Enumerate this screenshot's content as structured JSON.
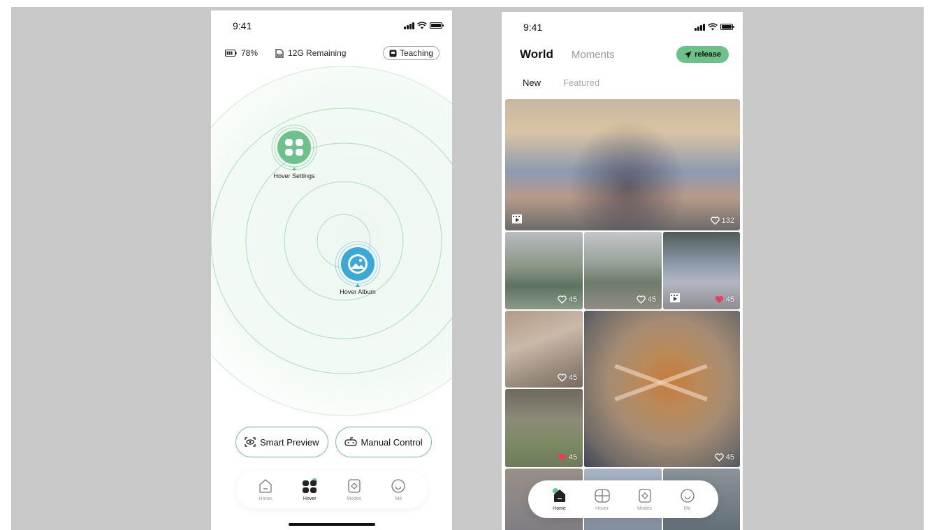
{
  "left_phone": {
    "status": {
      "time": "9:41"
    },
    "info": {
      "battery": "78%",
      "storage": "12G Remaining",
      "teaching_label": "Teaching"
    },
    "nodes": {
      "settings_label": "Hover Settings",
      "album_label": "Hover Album"
    },
    "actions": {
      "smart_preview": "Smart Preview",
      "manual_control": "Manual Control"
    },
    "tabs": [
      {
        "label": "Home",
        "icon": "home-icon"
      },
      {
        "label": "Hover",
        "icon": "hover-icon"
      },
      {
        "label": "Modes",
        "icon": "modes-icon"
      },
      {
        "label": "Me",
        "icon": "me-icon"
      }
    ],
    "colors": {
      "accent": "#6dc28c",
      "album": "#3aa9d8"
    }
  },
  "right_phone": {
    "status": {
      "time": "9:41"
    },
    "header": {
      "world": "World",
      "moments": "Moments",
      "release": "release"
    },
    "subtabs": {
      "new": "New",
      "featured": "Featured"
    },
    "feed": [
      {
        "likes": "132",
        "liked": false,
        "video": true
      },
      {
        "likes": "45",
        "liked": false,
        "video": false
      },
      {
        "likes": "45",
        "liked": false,
        "video": false
      },
      {
        "likes": "45",
        "liked": true,
        "video": true
      },
      {
        "likes": "45",
        "liked": false,
        "video": false
      },
      {
        "likes": "45",
        "liked": false,
        "video": false
      },
      {
        "likes": "45",
        "liked": true,
        "video": false
      }
    ],
    "tabs": [
      {
        "label": "Home",
        "icon": "home-icon"
      },
      {
        "label": "Hover",
        "icon": "hover-icon"
      },
      {
        "label": "Modes",
        "icon": "modes-icon"
      },
      {
        "label": "Me",
        "icon": "me-icon"
      }
    ],
    "colors": {
      "accent": "#6dc28c",
      "liked": "#e83d5a"
    }
  }
}
